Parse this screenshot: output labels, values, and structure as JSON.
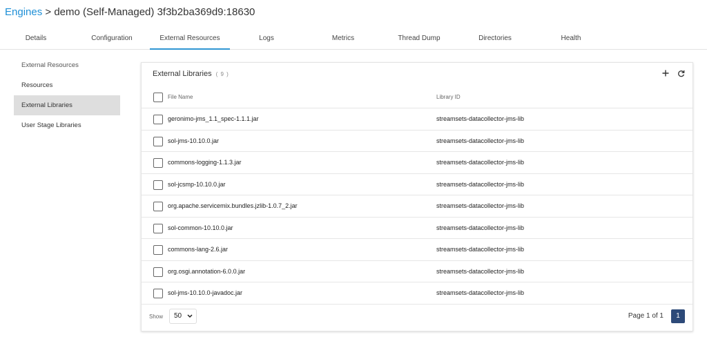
{
  "breadcrumb": {
    "link": "Engines",
    "separator": ">",
    "current": "demo (Self-Managed) 3f3b2ba369d9:18630"
  },
  "tabs": [
    {
      "label": "Details"
    },
    {
      "label": "Configuration"
    },
    {
      "label": "External Resources",
      "active": true
    },
    {
      "label": "Logs"
    },
    {
      "label": "Metrics"
    },
    {
      "label": "Thread Dump"
    },
    {
      "label": "Directories"
    },
    {
      "label": "Health"
    }
  ],
  "sidebar": {
    "items": [
      {
        "label": "External Resources"
      },
      {
        "label": "Resources"
      },
      {
        "label": "External Libraries",
        "active": true
      },
      {
        "label": "User Stage Libraries"
      }
    ]
  },
  "panel": {
    "title": "External Libraries",
    "count": "( 9 )",
    "add_icon": "plus-icon",
    "refresh_icon": "refresh-icon"
  },
  "table": {
    "columns": {
      "file_name": "File Name",
      "library_id": "Library ID"
    },
    "rows": [
      {
        "file": "geronimo-jms_1.1_spec-1.1.1.jar",
        "lib": "streamsets-datacollector-jms-lib"
      },
      {
        "file": "sol-jms-10.10.0.jar",
        "lib": "streamsets-datacollector-jms-lib"
      },
      {
        "file": "commons-logging-1.1.3.jar",
        "lib": "streamsets-datacollector-jms-lib"
      },
      {
        "file": "sol-jcsmp-10.10.0.jar",
        "lib": "streamsets-datacollector-jms-lib"
      },
      {
        "file": "org.apache.servicemix.bundles.jzlib-1.0.7_2.jar",
        "lib": "streamsets-datacollector-jms-lib"
      },
      {
        "file": "sol-common-10.10.0.jar",
        "lib": "streamsets-datacollector-jms-lib"
      },
      {
        "file": "commons-lang-2.6.jar",
        "lib": "streamsets-datacollector-jms-lib"
      },
      {
        "file": "org.osgi.annotation-6.0.0.jar",
        "lib": "streamsets-datacollector-jms-lib"
      },
      {
        "file": "sol-jms-10.10.0-javadoc.jar",
        "lib": "streamsets-datacollector-jms-lib"
      }
    ]
  },
  "footer": {
    "show_label": "Show",
    "page_size": "50",
    "page_info": "Page 1 of 1",
    "current_page": "1"
  },
  "colors": {
    "link": "#1e8fd6",
    "tab_active": "#2f95d3",
    "page_button": "#2d4a79",
    "sidebar_active": "#dedede"
  }
}
